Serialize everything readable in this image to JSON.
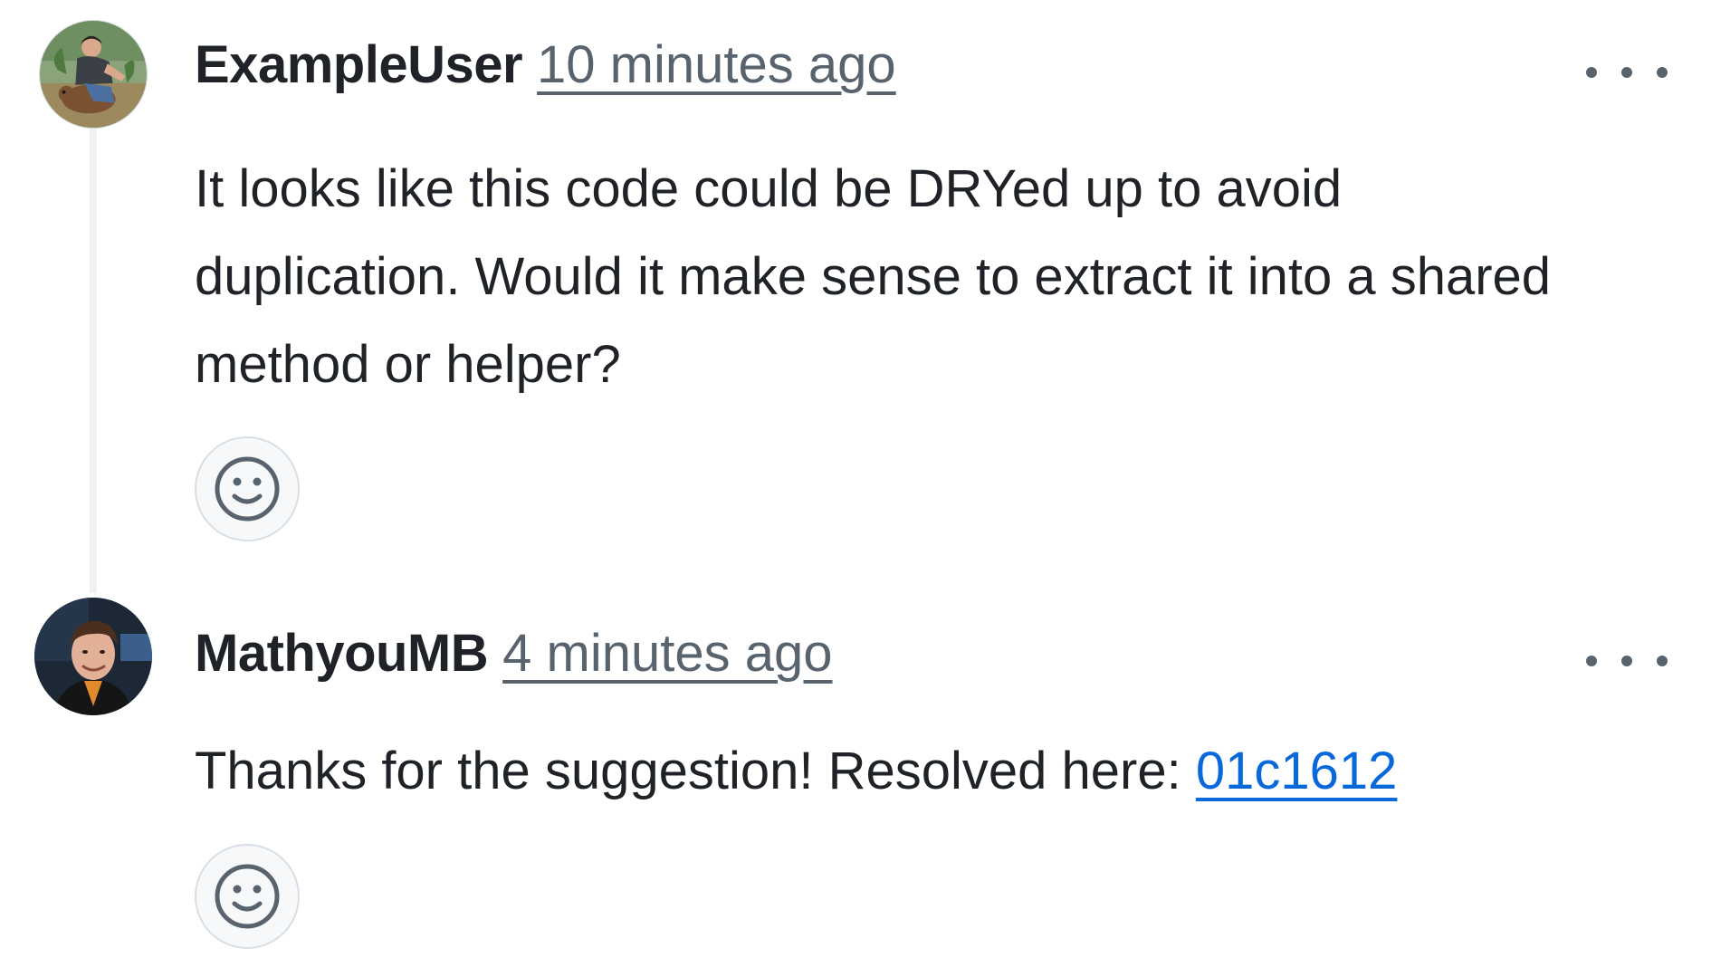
{
  "comments": [
    {
      "author": "ExampleUser",
      "timestamp": "10 minutes ago",
      "body": "It looks like this code could be DRYed up to avoid duplication. Would it make sense to extract it into a shared method or helper?",
      "avatar_icon": "user-avatar-photo",
      "menu_icon": "kebab-horizontal-icon",
      "reaction_icon": "smiley-icon"
    },
    {
      "author": "MathyouMB",
      "timestamp": "4 minutes ago",
      "body_prefix": "Thanks for the suggestion! Resolved here: ",
      "commit_link": "01c1612",
      "avatar_icon": "user-avatar-photo",
      "menu_icon": "kebab-horizontal-icon",
      "reaction_icon": "smiley-icon"
    }
  ],
  "colors": {
    "text": "#1f2328",
    "muted": "#59636e",
    "link": "#0969da",
    "thread_line": "#eff1f3",
    "reaction_bg": "#f6f8fa"
  }
}
